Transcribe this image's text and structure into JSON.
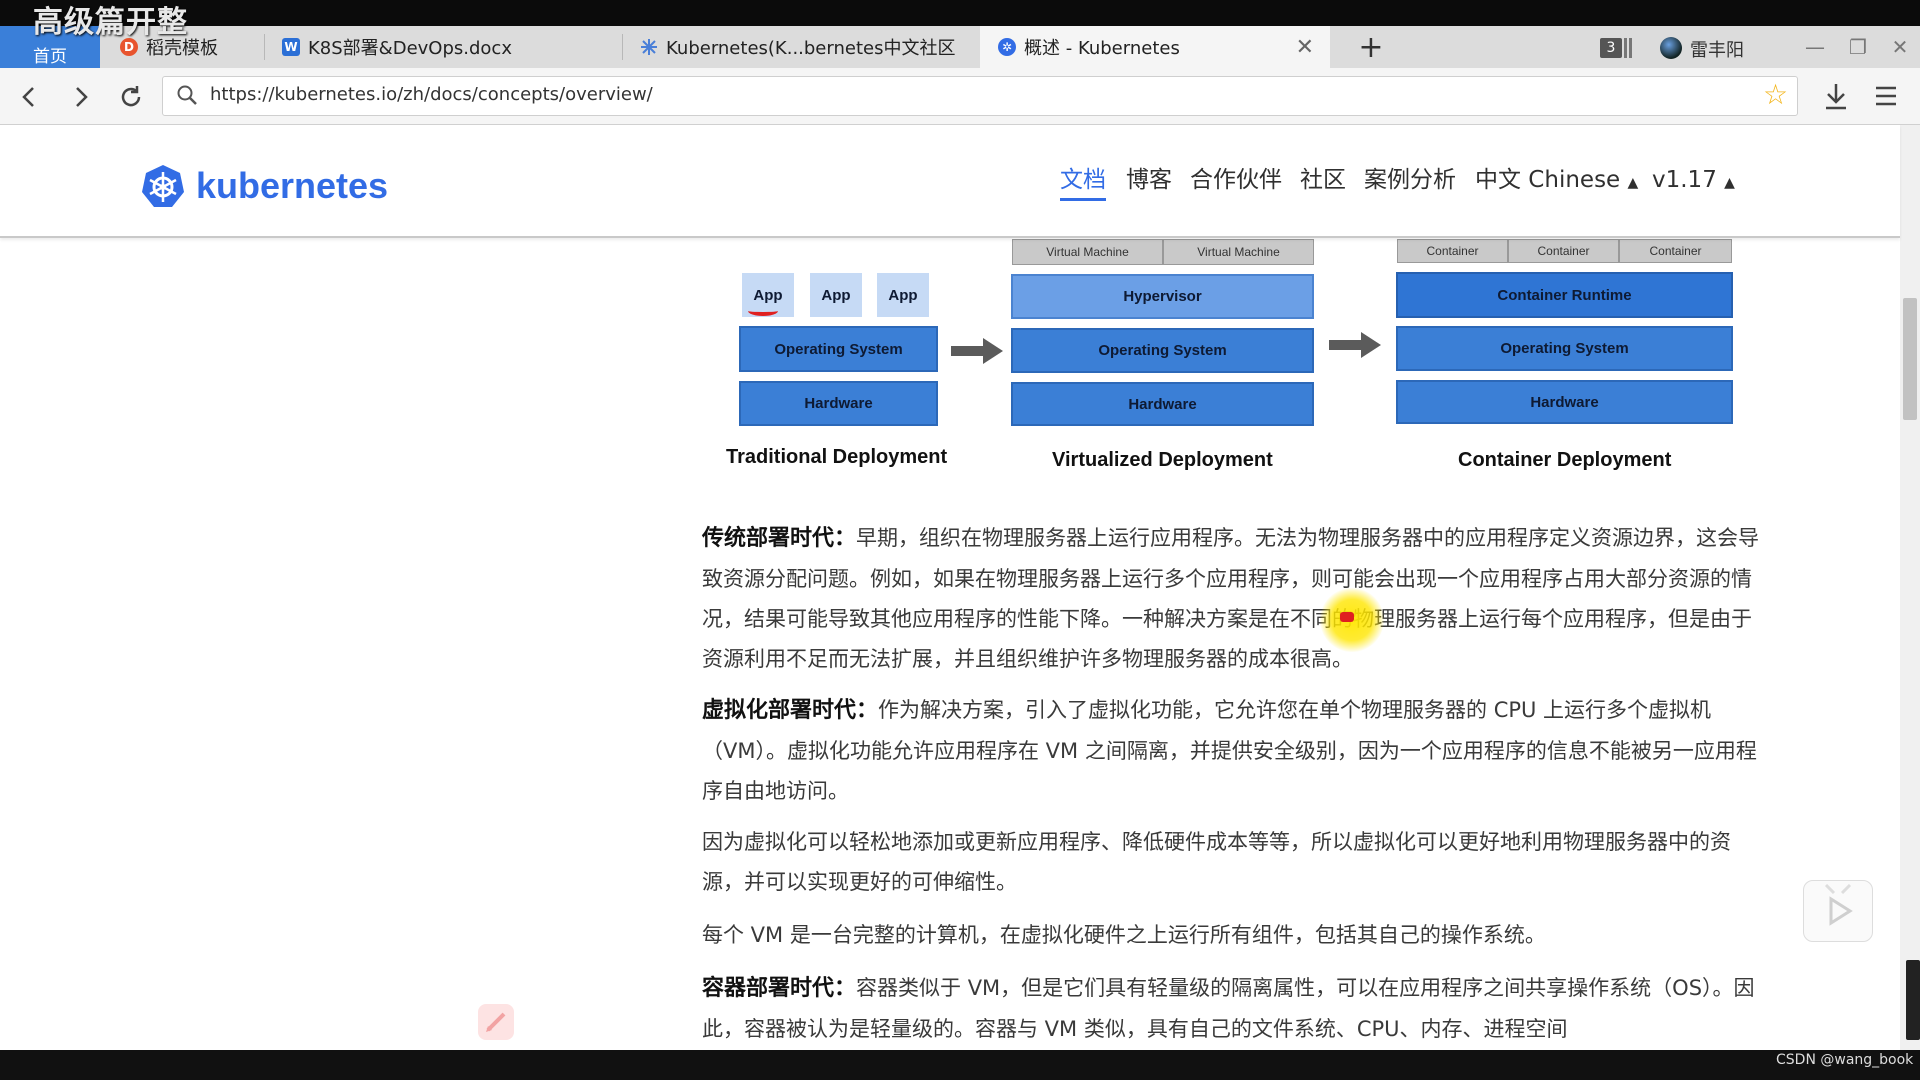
{
  "overlay_title": "高级篇开整",
  "browser": {
    "tabs": [
      {
        "label": "首页",
        "kind": "home"
      },
      {
        "label": "稻壳模板",
        "icon": "docer-icon"
      },
      {
        "label": "K8S部署&DevOps.docx",
        "icon": "wps-doc-icon"
      },
      {
        "label": "Kubernetes(K...bernetes中文社区",
        "icon": "kubernetes-icon"
      },
      {
        "label": "概述 - Kubernetes",
        "icon": "kubernetes-icon",
        "active": true
      }
    ],
    "tab_count": "3",
    "user_name": "雷丰阳",
    "url": "https://kubernetes.io/zh/docs/concepts/overview/"
  },
  "site": {
    "logo_text": "kubernetes",
    "nav": [
      {
        "label": "文档",
        "active": true
      },
      {
        "label": "博客"
      },
      {
        "label": "合作伙伴"
      },
      {
        "label": "社区"
      },
      {
        "label": "案例分析"
      },
      {
        "label": "中文 Chinese",
        "dropdown": true
      },
      {
        "label": "v1.17",
        "dropdown": true
      }
    ]
  },
  "diagram": {
    "traditional": {
      "apps": [
        "App",
        "App",
        "App"
      ],
      "os": "Operating System",
      "hw": "Hardware",
      "caption": "Traditional Deployment"
    },
    "virtualized": {
      "vms": [
        "Virtual Machine",
        "Virtual Machine"
      ],
      "hypervisor": "Hypervisor",
      "os": "Operating System",
      "hw": "Hardware",
      "caption": "Virtualized Deployment"
    },
    "container": {
      "containers": [
        "Container",
        "Container",
        "Container"
      ],
      "runtime": "Container Runtime",
      "os": "Operating System",
      "hw": "Hardware",
      "caption": "Container Deployment"
    }
  },
  "content": {
    "p1_title": "传统部署时代：",
    "p1_text": "早期，组织在物理服务器上运行应用程序。无法为物理服务器中的应用程序定义资源边界，这会导致资源分配问题。例如，如果在物理服务器上运行多个应用程序，则可能会出现一个应用程序占用大部分资源的情况，结果可能导致其他应用程序的性能下降。一种解决方案是在不同的物理服务器上运行每个应用程序，但是由于资源利用不足而无法扩展，并且组织维护许多物理服务器的成本很高。",
    "p2_title": "虚拟化部署时代：",
    "p2_text": "作为解决方案，引入了虚拟化功能，它允许您在单个物理服务器的 CPU 上运行多个虚拟机（VM）。虚拟化功能允许应用程序在 VM 之间隔离，并提供安全级别，因为一个应用程序的信息不能被另一应用程序自由地访问。",
    "p3_text": "因为虚拟化可以轻松地添加或更新应用程序、降低硬件成本等等，所以虚拟化可以更好地利用物理服务器中的资源，并可以实现更好的可伸缩性。",
    "p4_text": "每个 VM 是一台完整的计算机，在虚拟化硬件之上运行所有组件，包括其自己的操作系统。",
    "p5_title": "容器部署时代：",
    "p5_text": "容器类似于 VM，但是它们具有轻量级的隔离属性，可以在应用程序之间共享操作系统（OS）。因此，容器被认为是轻量级的。容器与 VM 类似，具有自己的文件系统、CPU、内存、进程空间"
  },
  "watermark": "CSDN @wang_book",
  "colors": {
    "accent": "#326ce5",
    "layer_blue": "#3b7fd6",
    "home_tab": "#3a7fd9"
  }
}
